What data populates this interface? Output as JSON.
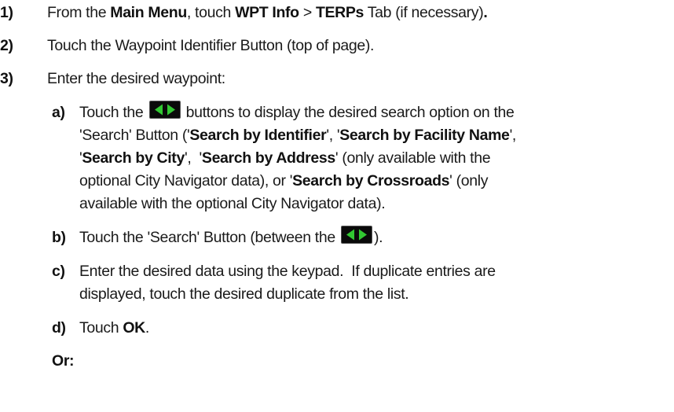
{
  "steps": [
    {
      "number": "1)",
      "p1": "From the ",
      "b1": "Main Menu",
      "p2": ", touch ",
      "b2": "WPT Info",
      "p3": " > ",
      "b3": "TERPs",
      "p4": " Tab (if necessary)",
      "b4": "."
    },
    {
      "number": "2)",
      "text": "Touch the Waypoint Identifier Button (top of page)."
    },
    {
      "number": "3)",
      "text": "Enter the desired waypoint:"
    }
  ],
  "substeps": {
    "a": {
      "letter": "a)",
      "l1_pre": "Touch the",
      "l1_post": "buttons to display the desired search option on the",
      "l2_p1": "'Search' Button ('",
      "l2_b1": "Search by Identifier",
      "l2_p2": "', '",
      "l2_b2": "Search by Facility Name",
      "l2_p3": "',",
      "l3_p1": "'",
      "l3_b1": "Search by City",
      "l3_p2": "',  '",
      "l3_b2": "Search by Address",
      "l3_p3": "' (only available with the",
      "l4_p1": "optional City Navigator data), or '",
      "l4_b1": "Search by Crossroads",
      "l4_p2": "' (only",
      "l5": "available with the optional City Navigator data)."
    },
    "b": {
      "letter": "b)",
      "pre": "Touch the 'Search' Button (between the",
      "post": ")."
    },
    "c": {
      "letter": "c)",
      "l1": "Enter the desired data using the keypad.  If duplicate entries are",
      "l2": "displayed, touch the desired duplicate from the list."
    },
    "d": {
      "letter": "d)",
      "pre": "Touch ",
      "bold": "OK",
      "post": "."
    }
  },
  "or_label": "Or:",
  "icons": {
    "arrow_buttons": "left-right-arrow-buttons-icon",
    "arrow_color": "#32c832"
  }
}
